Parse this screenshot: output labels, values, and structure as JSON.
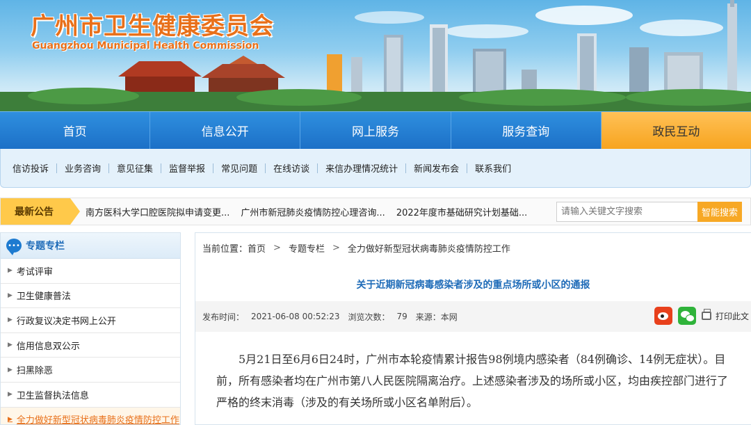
{
  "header": {
    "site_title": "广州市卫生健康委员会",
    "site_subtitle": "Guangzhou Municipal Health Commission"
  },
  "main_nav": {
    "items": [
      "首页",
      "信息公开",
      "网上服务",
      "服务查询",
      "政民互动"
    ],
    "active_index": 4
  },
  "sub_nav": {
    "items": [
      "信访投诉",
      "业务咨询",
      "意见征集",
      "监督举报",
      "常见问题",
      "在线访谈",
      "来信办理情况统计",
      "新闻发布会",
      "联系我们"
    ]
  },
  "notice": {
    "label": "最新公告",
    "items": [
      "南方医科大学口腔医院拟申请变更...",
      "广州市新冠肺炎疫情防控心理咨询...",
      "2022年度市基础研究计划基础..."
    ]
  },
  "search": {
    "placeholder": "请输入关键文字搜索",
    "button_label": "智能搜索"
  },
  "sidebar": {
    "title": "专题专栏",
    "items": [
      "考试评审",
      "卫生健康普法",
      "行政复议决定书网上公开",
      "信用信息双公示",
      "扫黑除恶",
      "卫生监督执法信息",
      "全力做好新型冠状病毒肺炎疫情防控工作"
    ],
    "active_index": 6
  },
  "breadcrumb": {
    "prefix": "当前位置：",
    "items": [
      "首页",
      "专题专栏",
      "全力做好新型冠状病毒肺炎疫情防控工作"
    ],
    "separator": ">"
  },
  "article": {
    "title": "关于近期新冠病毒感染者涉及的重点场所或小区的通报",
    "publish_label": "发布时间：",
    "publish_time": "2021-06-08 00:52:23",
    "views_label": "浏览次数：",
    "views": "79",
    "source_label": "来源：",
    "source": "本网",
    "print_label": "打印此文",
    "body": "5月21日至6月6日24时，广州市本轮疫情累计报告98例境内感染者（84例确诊、14例无症状）。目前，所有感染者均在广州市第八人民医院隔离治疗。上述感染者涉及的场所或小区，均由疾控部门进行了严格的终末消毒（涉及的有关场所或小区名单附后）。"
  },
  "colors": {
    "nav_blue": "#1c70c7",
    "accent_orange": "#f7a825",
    "title_orange": "#e8701a",
    "link_blue": "#1e6bb8"
  }
}
